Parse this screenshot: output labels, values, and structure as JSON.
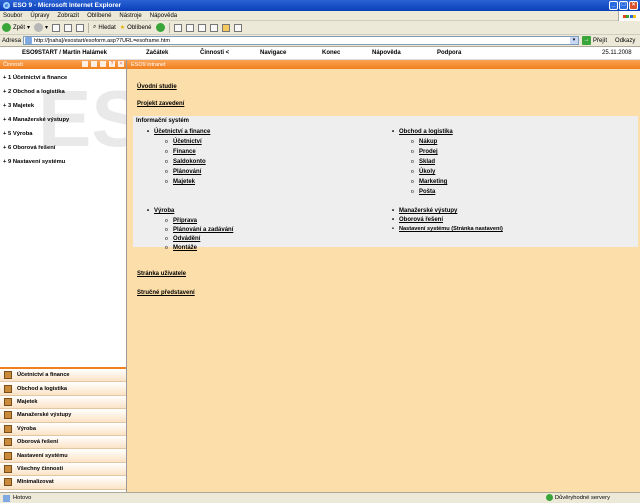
{
  "window": {
    "title": "ESO 9 - Microsoft Internet Explorer"
  },
  "menubar": {
    "items": [
      "Soubor",
      "Úpravy",
      "Zobrazit",
      "Oblíbené",
      "Nástroje",
      "Nápověda"
    ]
  },
  "toolbar": {
    "back": "Zpět",
    "search": "Hledat",
    "favorites": "Oblíbené"
  },
  "address": {
    "label": "Adresa",
    "url": "http://[naha]/esostart/esoform.asp?7URL=esoframe.htm",
    "go": "Přejít",
    "links": "Odkazy"
  },
  "app_header": {
    "user": "ESO9START / Martin Halámek",
    "nav": [
      "Začátek",
      "Činnosti <",
      "Navigace",
      "Konec",
      "Nápověda",
      "Podpora"
    ],
    "date": "25.11.2008"
  },
  "left_panel": {
    "header": "Činnosti",
    "watermark": "ESO",
    "tree": [
      "+ 1 Účetnictví a finance",
      "+ 2 Obchod a logistika",
      "+ 3 Majetek",
      "+ 4 Manažerské výstupy",
      "+ 5 Výroba",
      "+ 6 Oborová řešení",
      "+ 9 Nastavení systému"
    ],
    "shortcuts": [
      "Účetnictví a finance",
      "Obchod a logistika",
      "Majetek",
      "Manažerské výstupy",
      "Výroba",
      "Oborová řešení",
      "Nastavení systému",
      "Všechny činnosti",
      "Minimalizovat"
    ]
  },
  "main": {
    "header": "ESO9 intranet",
    "links_top": [
      "Úvodní studie",
      "Projekt zavedení"
    ],
    "info_title": "Informační systém",
    "groups": {
      "accounting": {
        "title": "Účetnictví a finance",
        "items": [
          "Účetnictví",
          "Finance",
          "Saldokonto",
          "Plánování",
          "Majetek"
        ]
      },
      "trade": {
        "title": "Obchod a logistika",
        "items": [
          "Nákup",
          "Prodej",
          "Sklad",
          "Úkoly",
          "Marketing",
          "Pošta"
        ]
      },
      "production": {
        "title": "Výroba",
        "items": [
          "Příprava",
          "Plánování a zadávání",
          "Odvádění",
          "Montáže"
        ]
      },
      "right_bottom": [
        "Manažerské výstupy",
        "Oborová řešení",
        "Nastavení systému (Stránka nastavení)"
      ]
    },
    "links_bottom": [
      "Stránka uživatele",
      "Stručné představení"
    ]
  },
  "statusbar": {
    "text": "Hotovo",
    "zone": "Důvěryhodné servery"
  },
  "colors": {
    "accent": "#f07f1d",
    "content_bg": "#fcdeaa",
    "title_bar": "#0a3fb8"
  }
}
